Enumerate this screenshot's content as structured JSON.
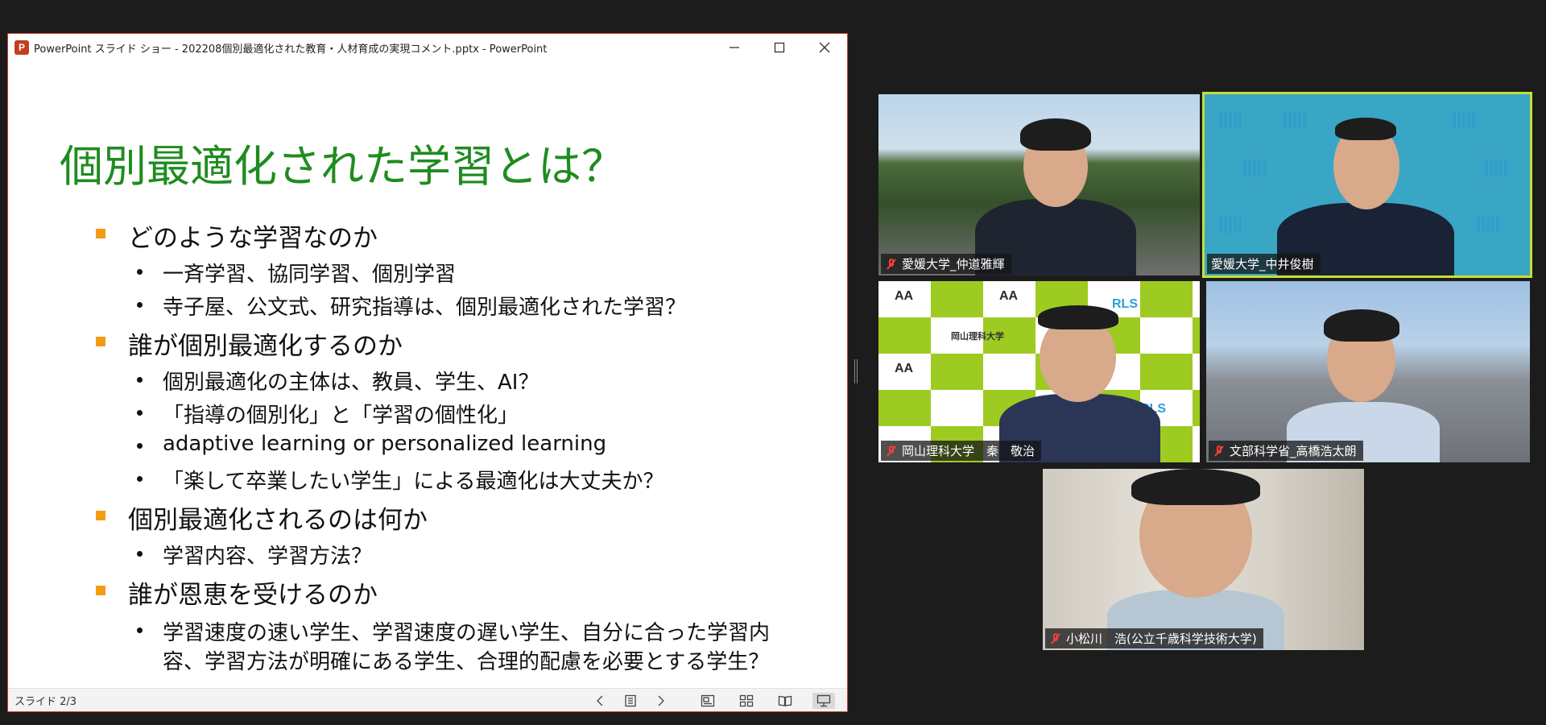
{
  "window": {
    "title": "PowerPoint スライド ショー  -  202208個別最適化された教育・人材育成の実現コメント.pptx - PowerPoint",
    "app_icon_letter": "P",
    "controls": [
      "minimize-icon",
      "maximize-icon",
      "close-icon"
    ]
  },
  "slide": {
    "title": "個別最適化された学習とは？",
    "bullets": [
      {
        "level": 1,
        "text": "どのような学習なのか"
      },
      {
        "level": 2,
        "text": "一斉学習、協同学習、個別学習"
      },
      {
        "level": 2,
        "text": "寺子屋、公文式、研究指導は、個別最適化された学習？"
      },
      {
        "level": 1,
        "text": "誰が個別最適化するのか"
      },
      {
        "level": 2,
        "text": "個別最適化の主体は、教員、学生、AI？"
      },
      {
        "level": 2,
        "text": "「指導の個別化」と「学習の個性化」"
      },
      {
        "level": 2,
        "text": "adaptive learning or personalized learning"
      },
      {
        "level": 2,
        "text": "「楽して卒業したい学生」による最適化は大丈夫か？"
      },
      {
        "level": 1,
        "text": "個別最適化されるのは何か"
      },
      {
        "level": 2,
        "text": "学習内容、学習方法？"
      },
      {
        "level": 1,
        "text": "誰が恩恵を受けるのか"
      },
      {
        "level": 2,
        "text": "学習速度の速い学生、学習速度の遅い学生、自分に合った学習内"
      },
      {
        "level": 2,
        "text": "容、学習方法が明確にある学生、合理的配慮を必要とする学生？"
      }
    ],
    "bullet_color": "#f39c12",
    "title_color": "#1f8c1f"
  },
  "statusbar": {
    "slide_counter": "スライド 2/3",
    "icons": [
      "previous-slide-icon",
      "slide-menu-icon",
      "next-slide-icon",
      "normal-view-icon",
      "slide-sorter-icon",
      "reading-view-icon",
      "slideshow-view-icon"
    ]
  },
  "participants": [
    {
      "name": "愛媛大学_仲道雅輝",
      "muted": true,
      "speaking": false
    },
    {
      "name": "愛媛大学_中井俊樹",
      "muted": false,
      "speaking": true
    },
    {
      "name": "岡山理科大学　秦　敬治",
      "muted": true,
      "speaking": false
    },
    {
      "name": "文部科学省_高橋浩太朗",
      "muted": true,
      "speaking": false
    },
    {
      "name": "小松川　浩(公立千歳科学技術大学)",
      "muted": true,
      "speaking": false
    }
  ],
  "background_signs": {
    "green_wall_a": "AA",
    "green_wall_b": "RLS",
    "green_wall_c": "岡山理科大学"
  },
  "colors": {
    "speaker_outline": "#c4e034",
    "mic_off": "#ff3b3b"
  }
}
